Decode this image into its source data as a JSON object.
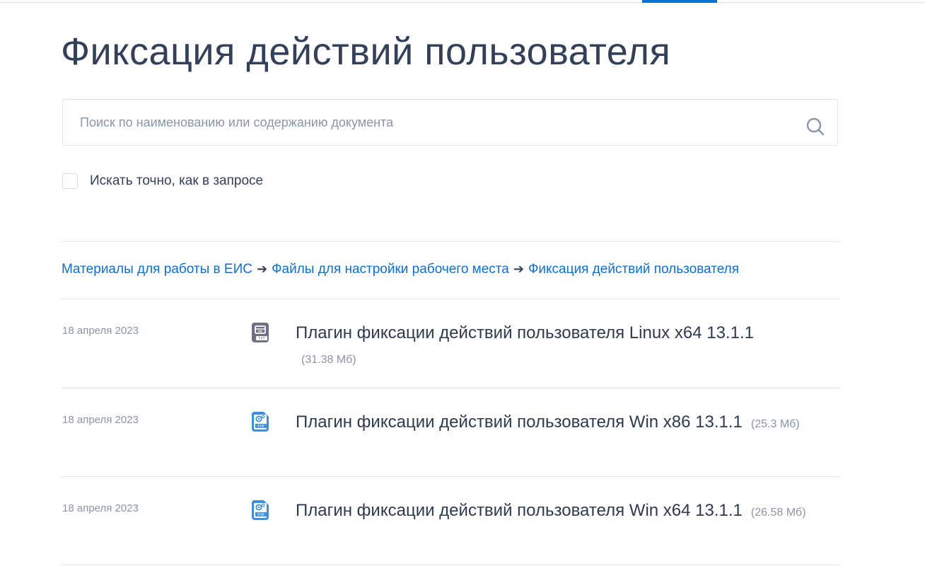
{
  "page": {
    "title": "Фиксация действий пользователя"
  },
  "search": {
    "placeholder": "Поиск по наименованию или содержанию документа",
    "value": "",
    "icon": "search-icon"
  },
  "exact_match": {
    "label": "Искать точно, как в запросе",
    "checked": false
  },
  "breadcrumb": {
    "items": [
      "Материалы для работы в ЕИС",
      "Файлы для настройки рабочего места",
      "Фиксация действий пользователя"
    ],
    "separator": "➔"
  },
  "documents": [
    {
      "date": "18 апреля 2023",
      "file_type": "TXT",
      "icon": "txt-file-icon",
      "title": "Плагин фиксации действий пользователя Linux x64 13.1.1",
      "size": "(31.38 Мб)"
    },
    {
      "date": "18 апреля 2023",
      "file_type": "EXE",
      "icon": "exe-file-icon",
      "title": "Плагин фиксации действий пользователя Win x86 13.1.1",
      "size": "(25.3 Мб)"
    },
    {
      "date": "18 апреля 2023",
      "file_type": "EXE",
      "icon": "exe-file-icon",
      "title": "Плагин фиксации действий пользователя Win x64 13.1.1",
      "size": "(26.58 Мб)"
    }
  ],
  "colors": {
    "accent": "#0d6fd4",
    "text": "#334059",
    "muted": "#8a95a6",
    "divider": "#e3e7ec",
    "txt_icon": "#6b7180",
    "exe_icon": "#3d8fdd"
  }
}
